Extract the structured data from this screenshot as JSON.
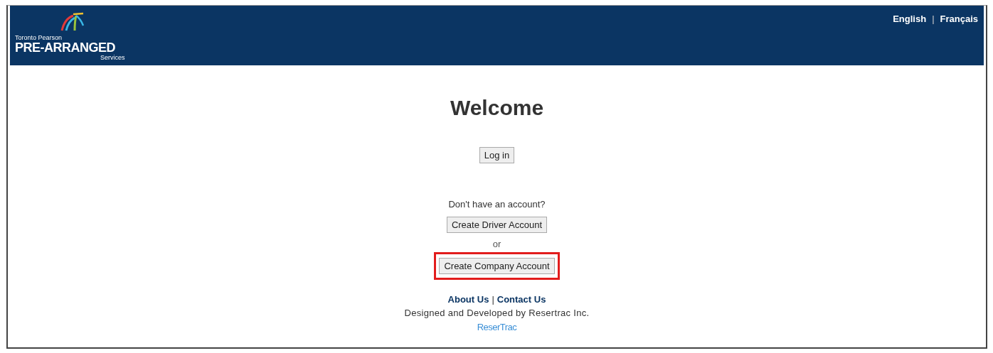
{
  "header": {
    "logo": {
      "line_1": "Toronto Pearson",
      "line_2": "PRE-ARRANGED",
      "line_3": "Services"
    },
    "languages": [
      {
        "label": "English"
      },
      {
        "label": "Français"
      }
    ],
    "separator": "|"
  },
  "main": {
    "title": "Welcome",
    "login_button": "Log in",
    "prompt": "Don't have an account?",
    "buttons": [
      {
        "label": "Create Driver Account",
        "highlighted": false
      },
      {
        "label": "Create Company Account",
        "highlighted": true
      }
    ],
    "or": "or"
  },
  "footer": {
    "links": [
      "About Us",
      "Contact Us"
    ],
    "separator": "|",
    "credit": "Designed and Developed by Resertrac Inc.",
    "brand": "ReserTrac"
  }
}
